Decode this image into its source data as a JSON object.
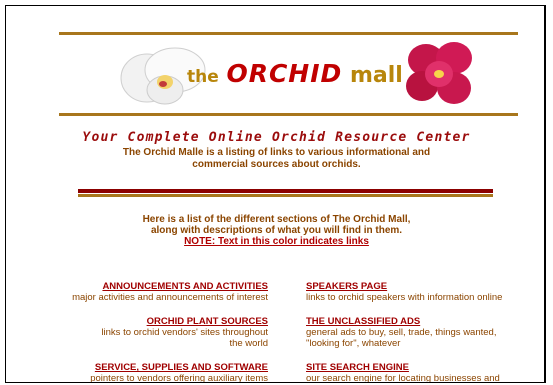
{
  "header": {
    "logo_the": "the",
    "logo_orchid": "ORCHID",
    "logo_mall": "mall"
  },
  "tagline": "Your Complete Online Orchid Resource Center",
  "intro": {
    "line1": "The Orchid Malle is a listing of links to various informational and",
    "line2": "commercial sources about orchids."
  },
  "sections_intro": {
    "line1": "Here is a list of the different sections of The Orchid Mall,",
    "line2": "along with descriptions of what you will find in them.",
    "note": "NOTE: Text in this color indicates links"
  },
  "left_sections": [
    {
      "title": "ANNOUNCEMENTS AND ACTIVITIES",
      "desc1": "major activities and announcements of interest",
      "desc2": ""
    },
    {
      "title": "ORCHID PLANT SOURCES",
      "desc1": "links to orchid vendors' sites throughout",
      "desc2": "the world"
    },
    {
      "title": "SERVICE, SUPPLIES AND SOFTWARE",
      "desc1": "pointers to vendors offering auxiliary items",
      "desc2": ""
    }
  ],
  "right_sections": [
    {
      "title": "SPEAKERS PAGE",
      "desc1": "links to orchid speakers with information online",
      "desc2": ""
    },
    {
      "title": "THE UNCLASSIFIED ADS",
      "desc1": "general ads to buy, sell, trade, things wanted,",
      "desc2": "\"looking for\", whatever"
    },
    {
      "title": "SITE SEARCH ENGINE",
      "desc1": "our search engine for locating businesses and",
      "desc2": ""
    }
  ],
  "colors": {
    "link": "#a00000",
    "text": "#8b4500",
    "rule_gold": "#a8761c",
    "rule_red": "#8b0000"
  }
}
